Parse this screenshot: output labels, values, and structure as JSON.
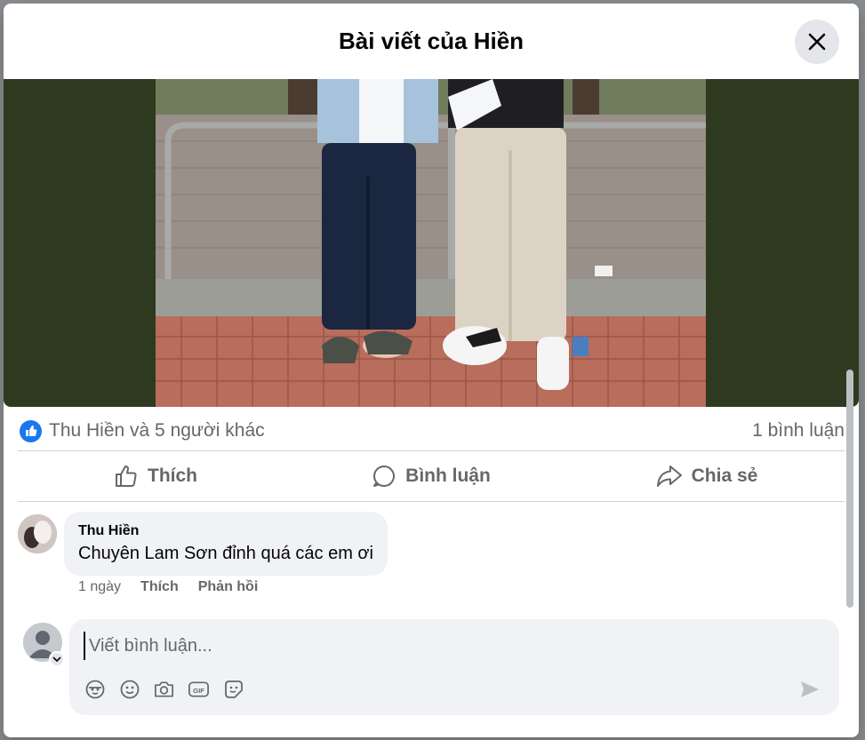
{
  "dialog": {
    "title": "Bài viết của Hiền",
    "close_icon": "close-icon"
  },
  "post": {
    "image_icon": "post-photo",
    "reactions_text": "Thu Hiền và 5 người khác",
    "comments_count": "1 bình luận",
    "accent_color": "#1877f2"
  },
  "actions": {
    "like_label": "Thích",
    "comment_label": "Bình luận",
    "share_label": "Chia sẻ"
  },
  "comment": {
    "author": "Thu Hiền",
    "text": "Chuyên Lam Sơn đỉnh quá các em ơi",
    "time": "1 ngày",
    "like_label": "Thích",
    "reply_label": "Phản hồi"
  },
  "composer": {
    "placeholder": "Viết bình luận...",
    "tools": [
      "avatar-sticker-icon",
      "emoji-icon",
      "camera-icon",
      "gif-icon",
      "sticker-icon"
    ],
    "send_icon": "send-icon"
  }
}
